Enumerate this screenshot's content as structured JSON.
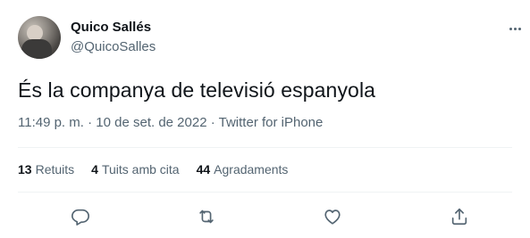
{
  "author": {
    "name": "Quico Sallés",
    "handle": "@QuicoSalles"
  },
  "tweet": {
    "text": "És la companya de televisió espanyola",
    "time": "11:49 p. m.",
    "separator": "·",
    "date": "10 de set. de 2022",
    "source": "Twitter for iPhone"
  },
  "stats": {
    "retweets_count": "13",
    "retweets_label": "Retuits",
    "quotes_count": "4",
    "quotes_label": "Tuits amb cita",
    "likes_count": "44",
    "likes_label": "Agradaments"
  },
  "icons": {
    "more": "more-icon",
    "reply": "reply-icon",
    "retweet": "retweet-icon",
    "like": "heart-icon",
    "share": "share-icon"
  },
  "colors": {
    "text_primary": "#0f1419",
    "text_secondary": "#536471",
    "divider": "#eff3f4"
  }
}
